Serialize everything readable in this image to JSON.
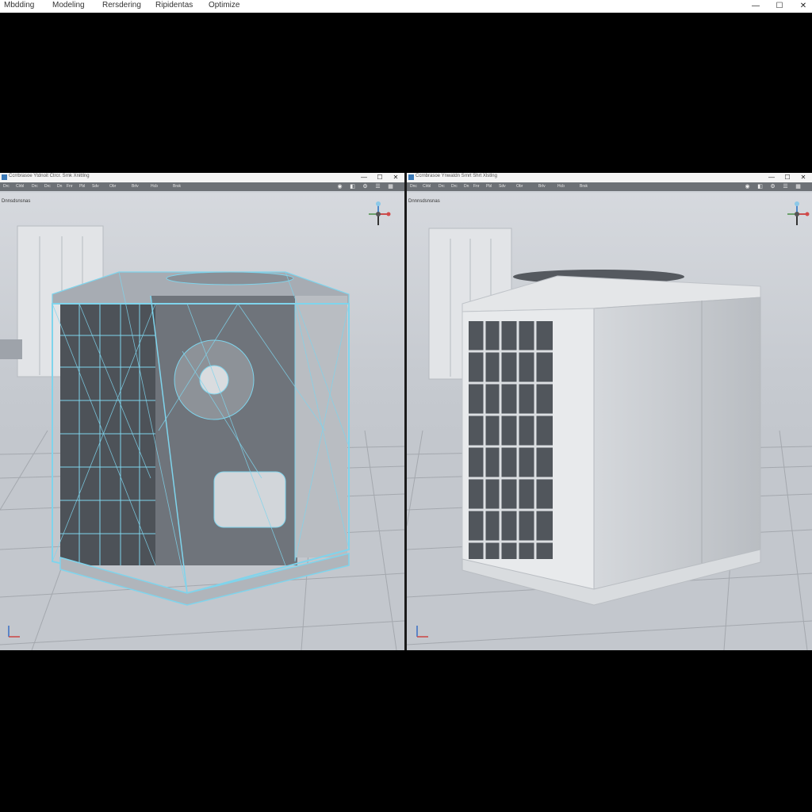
{
  "menu": {
    "items": [
      {
        "label": "Mbdding"
      },
      {
        "label": "Modeling"
      },
      {
        "label": "Rersdering"
      },
      {
        "label": "Ripidentas"
      },
      {
        "label": "Optimize"
      }
    ],
    "window_controls": {
      "minimize": "—",
      "maximize": "☐",
      "close": "✕"
    }
  },
  "left_panel": {
    "title": "Ccrrbrasoe  Ytdnoit  Ctrcr. Srnk  Xnittlng",
    "toolbar": [
      "Drc",
      "Clrbl",
      "Drc",
      "Drc",
      "Dn",
      "Fnr",
      "Pbl",
      "Sdv",
      "Obr",
      "Brlv",
      "Hcb",
      "Brsk"
    ],
    "viewport_label": "Dnnsdsnsnas",
    "render_mode": "wireframe"
  },
  "right_panel": {
    "title": "Ccrnbrasoe  Ynwatdn  Srnrt  Shrt  Xlstlng",
    "toolbar": [
      "Dnc",
      "Clrbl",
      "Drc",
      "Drc",
      "Dn",
      "Fnr",
      "Pbl",
      "Sdv",
      "Obr",
      "Brlv",
      "Hcb",
      "Brsk"
    ],
    "viewport_label": "Dnnnsdsnsnas",
    "render_mode": "shaded"
  },
  "colors": {
    "wireframe": "#7fd4ec",
    "viewport_bg": "#ced2d8",
    "toolbar_bg": "#6d7176",
    "titlebar_bg": "#f5f5f5"
  },
  "icons": [
    "app-icon",
    "minimize-icon",
    "maximize-icon",
    "close-icon",
    "view-gizmo-icon",
    "axis-triad-icon"
  ]
}
